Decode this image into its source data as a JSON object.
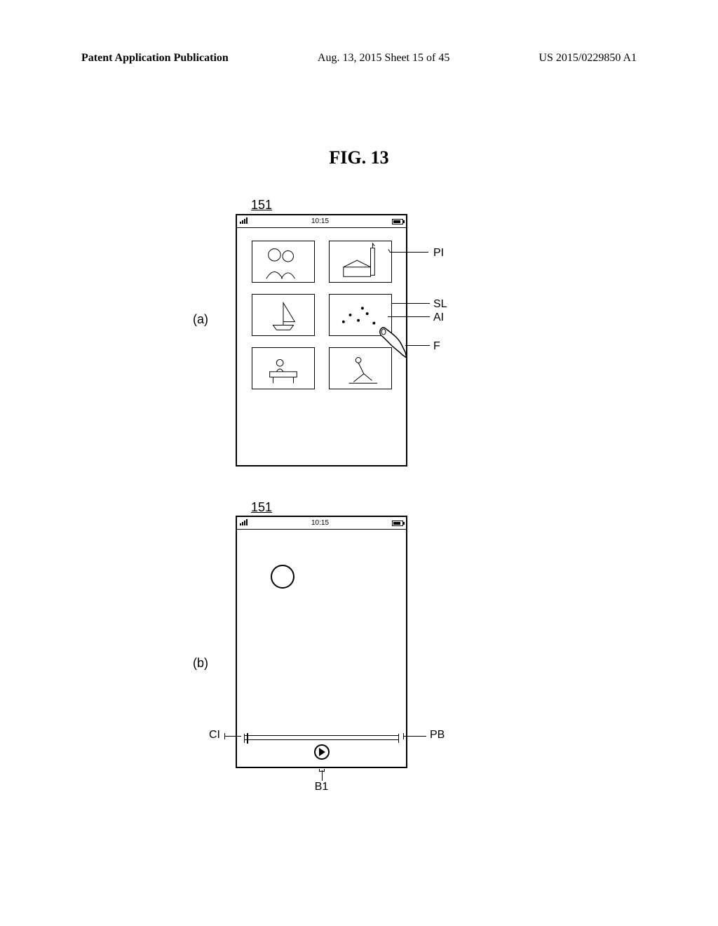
{
  "header": {
    "left": "Patent Application Publication",
    "center": "Aug. 13, 2015  Sheet 15 of 45",
    "right": "US 2015/0229850 A1"
  },
  "figure_title": "FIG. 13",
  "sub_labels": {
    "a": "(a)",
    "b": "(b)"
  },
  "phone_ref": "151",
  "status_time": "10:15",
  "callouts": {
    "PI": "PI",
    "SL": "SL",
    "AI": "AI",
    "F": "F",
    "CI": "CI",
    "PB": "PB",
    "B1": "B1"
  }
}
